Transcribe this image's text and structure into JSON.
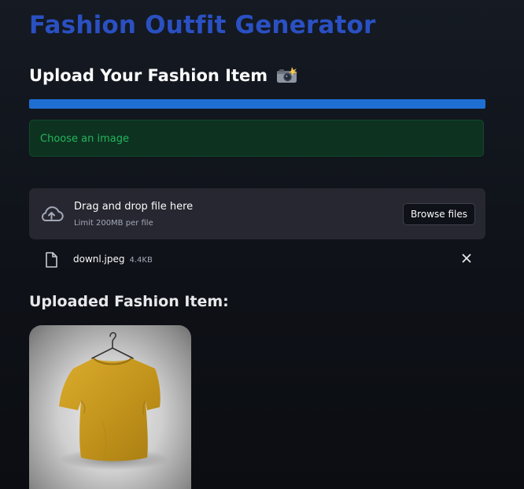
{
  "app": {
    "title": "Fashion Outfit Generator"
  },
  "upload": {
    "heading": "Upload Your Fashion Item",
    "heading_icon": "camera-with-flash-icon",
    "progress_fraction": 1.0,
    "info_message": "Choose an image",
    "dropzone_title": "Drag and drop file here",
    "dropzone_limit": "Limit 200MB per file",
    "browse_label": "Browse files"
  },
  "file": {
    "name": "downl.jpeg",
    "size": "4.4KB"
  },
  "uploaded": {
    "heading": "Uploaded Fashion Item:",
    "image_subject": "yellow-tshirt-on-hanger"
  },
  "colors": {
    "title": "#2a50c2",
    "progress": "#1f6fd3",
    "info_bg": "#0d3320",
    "info_text": "#27b35d",
    "shirt": "#c79a1f"
  }
}
